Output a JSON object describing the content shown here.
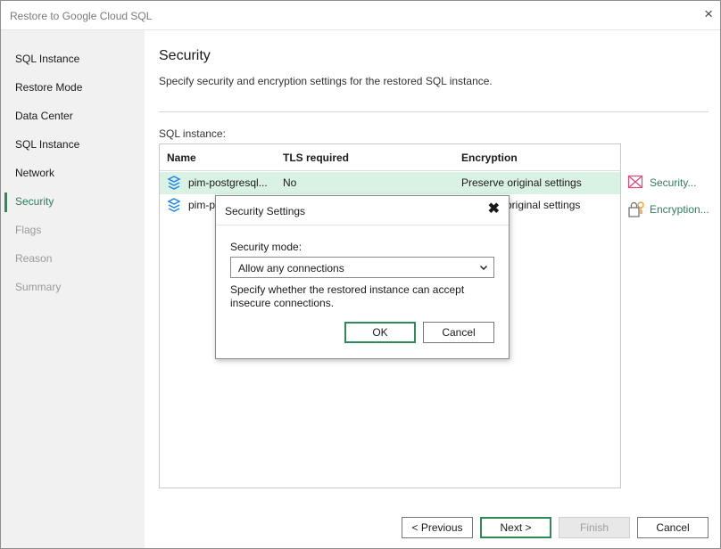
{
  "window": {
    "title": "Restore to Google Cloud SQL",
    "close_glyph": "×"
  },
  "sidebar": {
    "items": [
      {
        "label": "SQL Instance",
        "state": "normal"
      },
      {
        "label": "Restore Mode",
        "state": "normal"
      },
      {
        "label": "Data Center",
        "state": "normal"
      },
      {
        "label": "SQL Instance",
        "state": "normal"
      },
      {
        "label": "Network",
        "state": "normal"
      },
      {
        "label": "Security",
        "state": "active"
      },
      {
        "label": "Flags",
        "state": "disabled"
      },
      {
        "label": "Reason",
        "state": "disabled"
      },
      {
        "label": "Summary",
        "state": "disabled"
      }
    ]
  },
  "main": {
    "title": "Security",
    "description": "Specify security and encryption settings for the restored SQL instance.",
    "instance_label": "SQL instance:",
    "table": {
      "columns": [
        "Name",
        "TLS required",
        "Encryption"
      ],
      "rows": [
        {
          "name": "pim-postgresql...",
          "tls": "No",
          "encryption": "Preserve original settings",
          "selected": true
        },
        {
          "name": "pim-p",
          "tls": "",
          "encryption": "original settings",
          "selected": false
        }
      ]
    },
    "actions": {
      "security": "Security...",
      "encryption": "Encryption..."
    }
  },
  "footer": {
    "previous": "< Previous",
    "next": "Next >",
    "finish": "Finish",
    "cancel": "Cancel"
  },
  "dialog": {
    "title": "Security Settings",
    "close_glyph": "✖",
    "mode_label": "Security mode:",
    "mode_value": "Allow any connections",
    "description": "Specify whether the restored instance can accept insecure connections.",
    "ok": "OK",
    "cancel": "Cancel"
  },
  "colors": {
    "accent": "#2e8b57",
    "selected_row": "#d9f2e3",
    "sidebar_bg": "#f1f1f1",
    "security_icon": "#e0457b",
    "key_icon": "#e8a33d"
  },
  "icons": {
    "db": "database-stack-icon",
    "security": "shield-cross-icon",
    "encryption": "lock-key-icon"
  }
}
